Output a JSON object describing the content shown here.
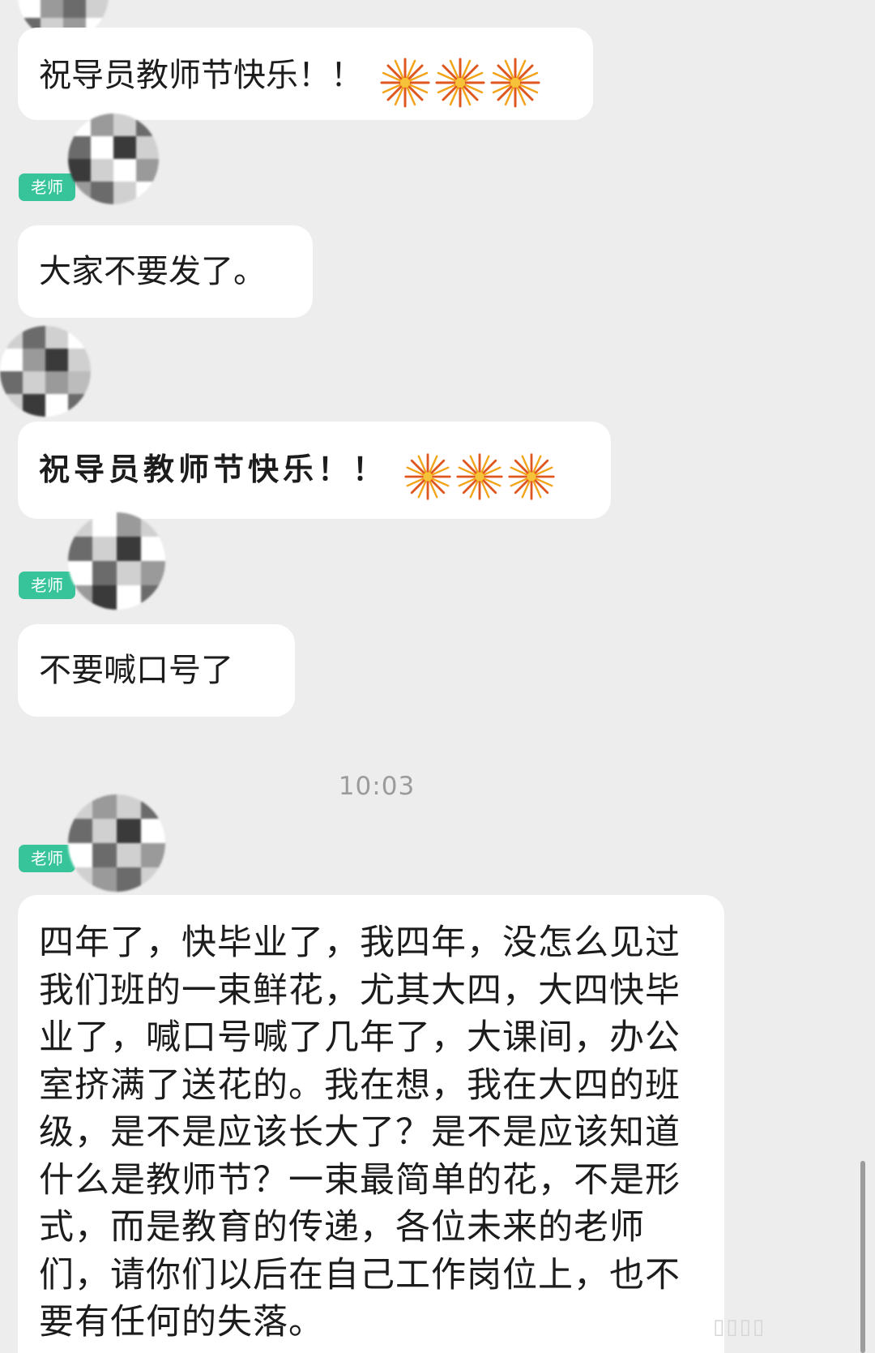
{
  "chat": {
    "messages": [
      {
        "text": "祝导员教师节快乐！！",
        "emoji": "fireworks-icon"
      },
      {
        "sender_badge": "老师",
        "text": "大家不要发了。"
      },
      {
        "text": "祝导员教师节快乐！！",
        "emoji": "fireworks-icon"
      },
      {
        "sender_badge": "老师",
        "text": "不要喊口号了"
      },
      {
        "timestamp": "10:03"
      },
      {
        "sender_badge": "老师",
        "text": "四年了，快毕业了，我四年，没怎么见过我们班的一束鲜花，尤其大四，大四快毕业了，喊口号喊了几年了，大课间，办公室挤满了送花的。我在想，我在大四的班级，是不是应该长大了？是不是应该知道什么是教师节？一束最简单的花，不是形式，而是教育的传递，各位未来的老师们，请你们以后在自己工作岗位上，也不要有任何的失落。"
      }
    ]
  },
  "colors": {
    "background": "#ededed",
    "bubble": "#ffffff",
    "teacher_badge": "#38c49a",
    "timestamp_text": "#9b9b9b"
  }
}
